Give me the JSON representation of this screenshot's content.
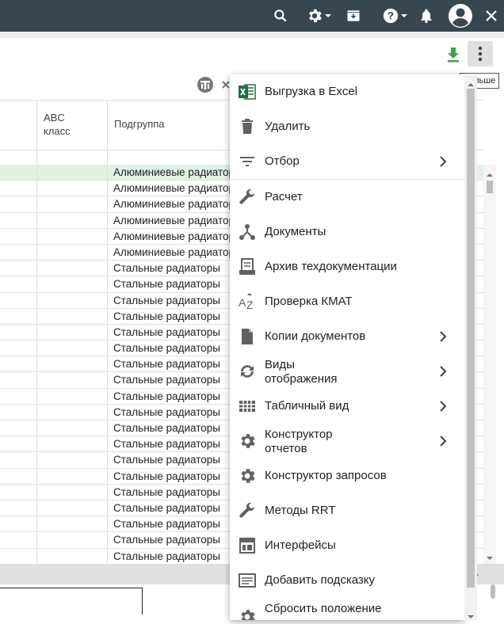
{
  "colors": {
    "topbar": "#37474f",
    "accent_green": "#2e7d32",
    "selected_row": "#e3f2e3"
  },
  "header": {
    "icons": [
      "search-icon",
      "gear-icon",
      "archive-icon",
      "help-icon",
      "bell-icon",
      "account-icon",
      "close-icon"
    ]
  },
  "toolbar": {
    "download_icon": "download-icon",
    "more_icon": "more-vert-icon",
    "more_tooltip": "Больше"
  },
  "table": {
    "columns": [
      "",
      "ABC\nкласс",
      "Подгруппа"
    ],
    "col_abc_line1": "ABC",
    "col_abc_line2": "класс",
    "col_subgroup": "Подгруппа",
    "rows": [
      "Алюминиевые радиаторы",
      "Алюминиевые радиаторы",
      "Алюминиевые радиаторы",
      "Алюминиевые радиаторы",
      "Алюминиевые радиаторы",
      "Алюминиевые радиаторы",
      "Стальные радиаторы",
      "Стальные радиаторы",
      "Стальные радиаторы",
      "Стальные радиаторы",
      "Стальные радиаторы",
      "Стальные радиаторы",
      "Стальные радиаторы",
      "Стальные радиаторы",
      "Стальные радиаторы",
      "Стальные радиаторы",
      "Стальные радиаторы",
      "Стальные радиаторы",
      "Стальные радиаторы",
      "Стальные радиаторы",
      "Стальные радиаторы",
      "Стальные радиаторы",
      "Стальные радиаторы",
      "Стальные радиаторы",
      "Стальные радиаторы"
    ]
  },
  "menu": {
    "items": [
      {
        "label": "Выгрузка в Excel",
        "icon": "excel-icon",
        "submenu": false
      },
      {
        "label": "Удалить",
        "icon": "trash-icon",
        "submenu": false
      },
      {
        "label": "Отбор",
        "icon": "filter-icon",
        "submenu": true
      },
      {
        "label": "Расчет",
        "icon": "wrench-icon",
        "submenu": false
      },
      {
        "label": "Документы",
        "icon": "document-tree-icon",
        "submenu": false
      },
      {
        "label": "Архив техдокументации",
        "icon": "archive-docs-icon",
        "submenu": false
      },
      {
        "label": "Проверка КМАТ",
        "icon": "az-sort-icon",
        "submenu": false
      },
      {
        "label": "Копии документов",
        "icon": "file-icon",
        "submenu": true
      },
      {
        "label": "Виды\nотображения",
        "line1": "Виды",
        "line2": "отображения",
        "icon": "view-cycle-icon",
        "submenu": true
      },
      {
        "label": "Табличный вид",
        "icon": "grid-icon",
        "submenu": true
      },
      {
        "label": "Конструктор\nотчетов",
        "line1": "Конструктор",
        "line2": "отчетов",
        "icon": "gear-icon",
        "submenu": true
      },
      {
        "label": "Конструктор запросов",
        "icon": "gear-icon",
        "submenu": false
      },
      {
        "label": "Методы RRT",
        "icon": "wrench-icon",
        "submenu": false
      },
      {
        "label": "Интерфейсы",
        "icon": "layout-icon",
        "submenu": false
      },
      {
        "label": "Добавить подсказку",
        "icon": "hint-icon",
        "submenu": false
      },
      {
        "label": "Сбросить положение",
        "icon": "gear-icon",
        "submenu": false
      }
    ]
  }
}
